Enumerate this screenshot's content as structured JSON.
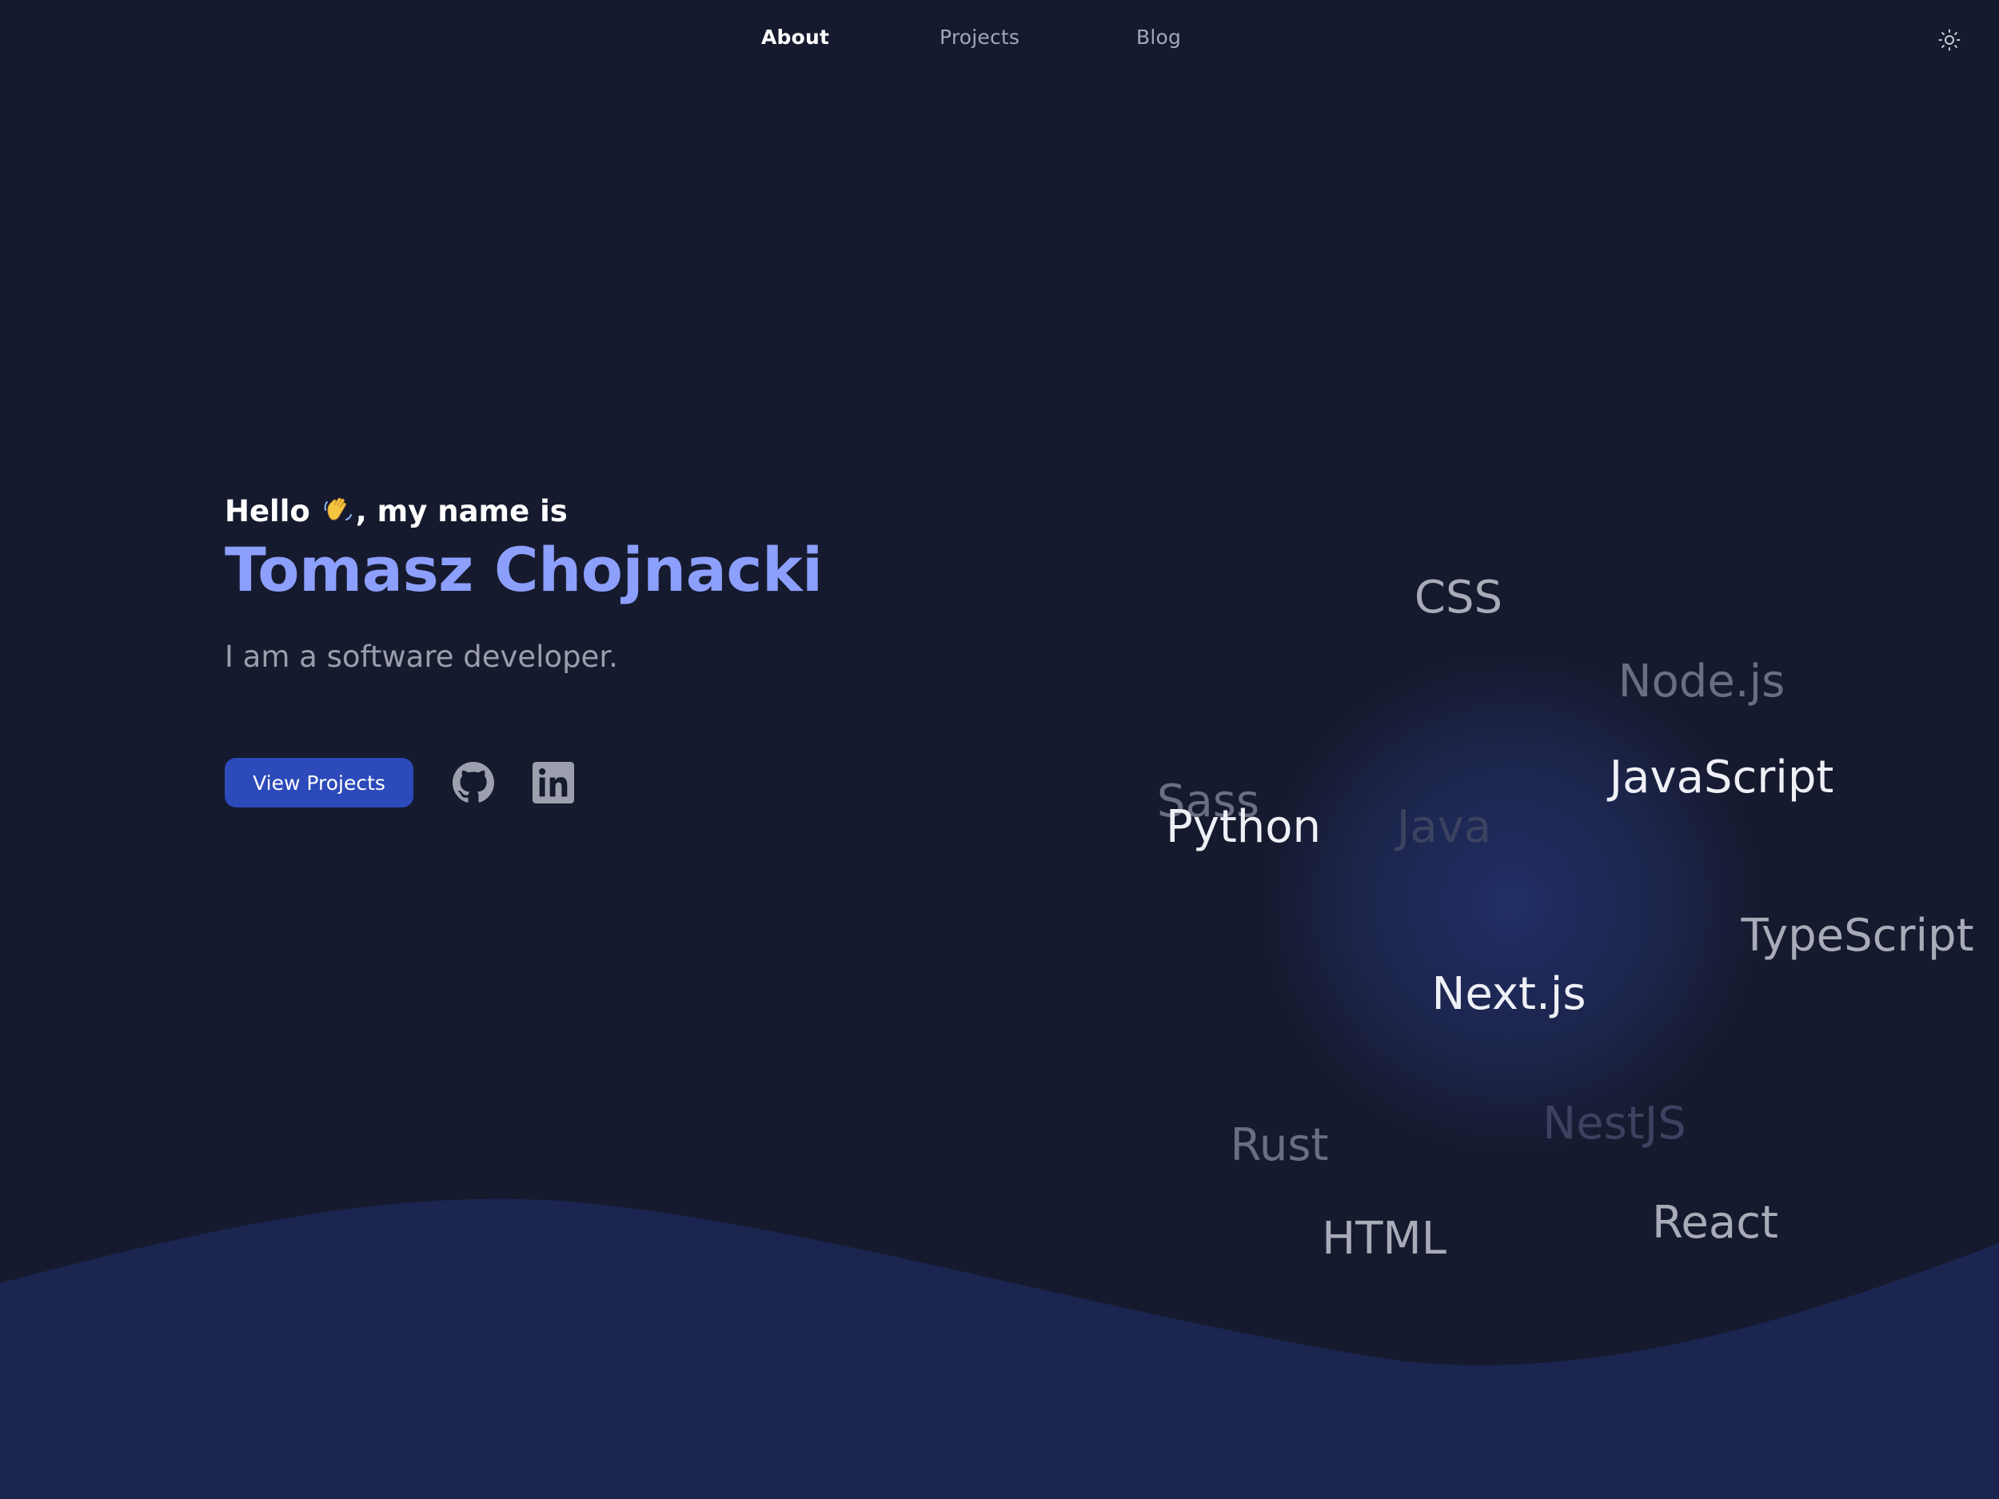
{
  "nav": {
    "items": [
      {
        "label": "About",
        "active": true
      },
      {
        "label": "Projects",
        "active": false
      },
      {
        "label": "Blog",
        "active": false
      }
    ],
    "theme_toggle_icon": "sun-icon"
  },
  "hero": {
    "greeting_prefix": "Hello",
    "greeting_emoji": "👋",
    "greeting_suffix": ", my name is",
    "name": "Tomasz Chojnacki",
    "subtitle": "I am a software developer.",
    "cta_label": "View Projects",
    "social_icons": [
      "github-icon",
      "linkedin-icon"
    ]
  },
  "tag_sphere": {
    "tags": [
      "CSS",
      "Node.js",
      "JavaScript",
      "Sass",
      "Python",
      "Java",
      "TypeScript",
      "Next.js",
      "NestJS",
      "Rust",
      "HTML",
      "React"
    ]
  },
  "colors": {
    "background": "#161a2e",
    "wave": "#1b2550",
    "accent": "#8c9ffd",
    "button": "#2d4aba"
  }
}
